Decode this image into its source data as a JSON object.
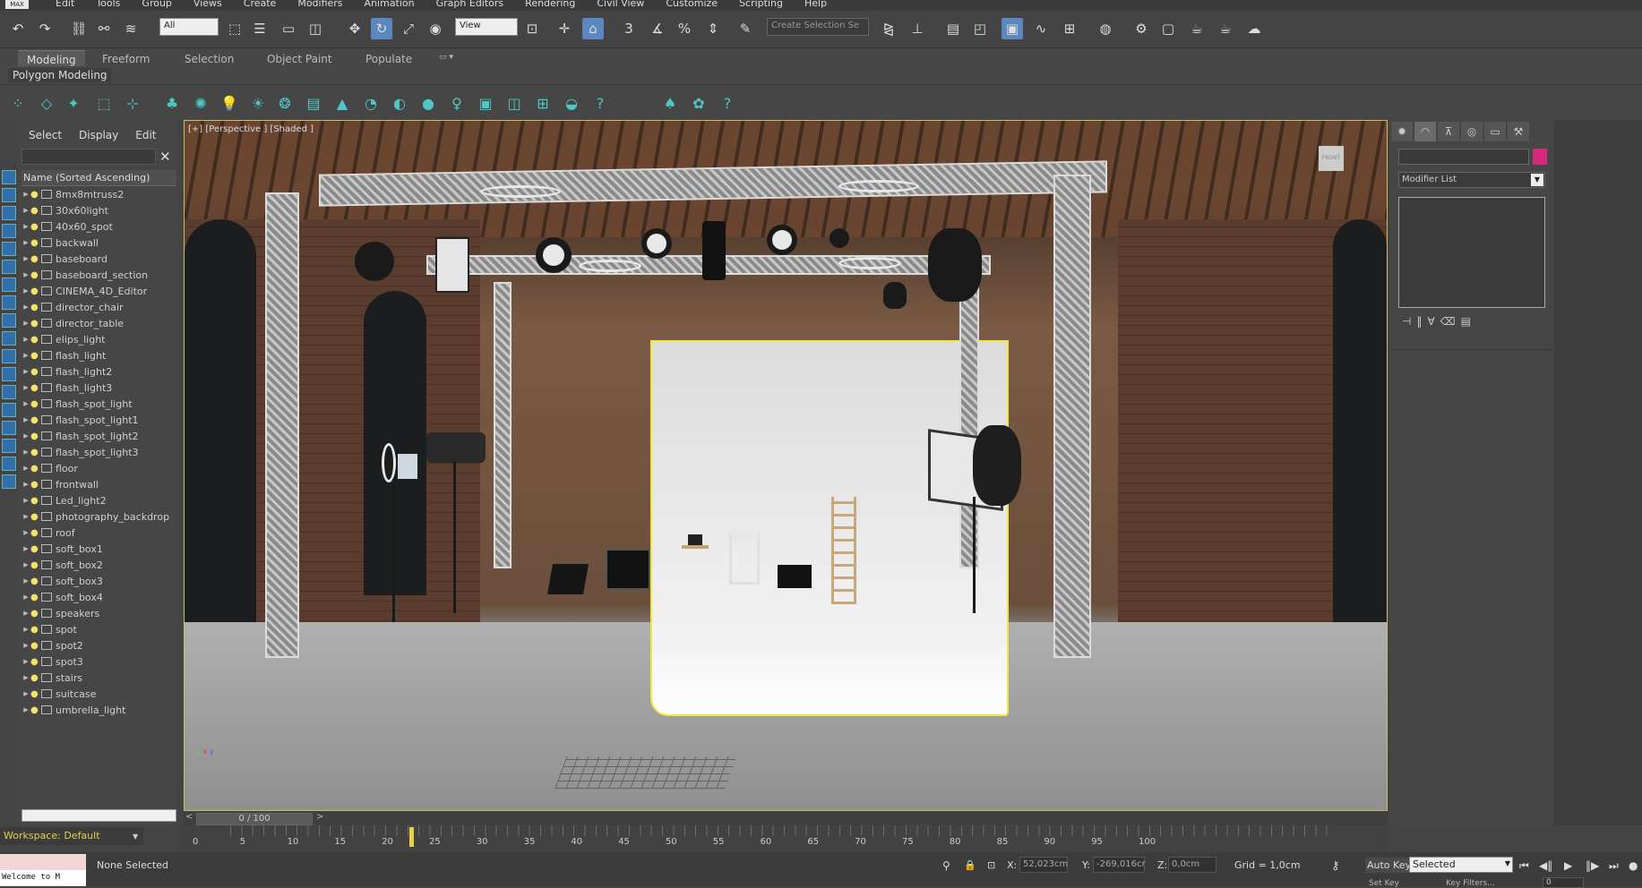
{
  "menubar": {
    "logo": "MAX",
    "items": [
      "Edit",
      "Tools",
      "Group",
      "Views",
      "Create",
      "Modifiers",
      "Animation",
      "Graph Editors",
      "Rendering",
      "Civil View",
      "Customize",
      "Scripting",
      "Help"
    ]
  },
  "main_toolbar": {
    "selection_filter": "All",
    "reference_coord": "View",
    "named_selection_placeholder": "Create Selection Se",
    "snap_labels": [
      "3",
      "%"
    ]
  },
  "ribbon": {
    "tabs": [
      "Modeling",
      "Freeform",
      "Selection",
      "Object Paint",
      "Populate"
    ],
    "active_tab": "Modeling",
    "panel_label": "Polygon Modeling"
  },
  "scene_explorer": {
    "tabs": [
      "Select",
      "Display",
      "Edit"
    ],
    "column_header": "Name (Sorted Ascending)",
    "objects": [
      {
        "name": "8mx8mtruss2",
        "light": true
      },
      {
        "name": "30x60light",
        "light": true
      },
      {
        "name": "40x60_spot",
        "light": true
      },
      {
        "name": "backwall",
        "light": true
      },
      {
        "name": "baseboard",
        "light": true
      },
      {
        "name": "baseboard_section",
        "light": true
      },
      {
        "name": "CINEMA_4D_Editor",
        "light": true
      },
      {
        "name": "director_chair",
        "light": true
      },
      {
        "name": "director_table",
        "light": true
      },
      {
        "name": "elips_light",
        "light": true
      },
      {
        "name": "flash_light",
        "light": true
      },
      {
        "name": "flash_light2",
        "light": true
      },
      {
        "name": "flash_light3",
        "light": true
      },
      {
        "name": "flash_spot_light",
        "light": true
      },
      {
        "name": "flash_spot_light1",
        "light": true
      },
      {
        "name": "flash_spot_light2",
        "light": true
      },
      {
        "name": "flash_spot_light3",
        "light": true
      },
      {
        "name": "floor",
        "light": true
      },
      {
        "name": "frontwall",
        "light": true
      },
      {
        "name": "Led_light2",
        "light": true
      },
      {
        "name": "photography_backdrop",
        "light": true
      },
      {
        "name": "roof",
        "light": true
      },
      {
        "name": "soft_box1",
        "light": true
      },
      {
        "name": "soft_box2",
        "light": true
      },
      {
        "name": "soft_box3",
        "light": true
      },
      {
        "name": "soft_box4",
        "light": true
      },
      {
        "name": "speakers",
        "light": true
      },
      {
        "name": "spot",
        "light": true
      },
      {
        "name": "spot2",
        "light": true
      },
      {
        "name": "spot3",
        "light": true
      },
      {
        "name": "stairs",
        "light": true
      },
      {
        "name": "suitcase",
        "light": true
      },
      {
        "name": "umbrella_light",
        "light": true
      }
    ]
  },
  "viewport": {
    "label": "[+] [Perspective ] [Shaded ]",
    "navcube_label": "FRONT"
  },
  "command_panel": {
    "modifier_list": "Modifier List",
    "object_color": "#d8287c"
  },
  "timeline": {
    "slider_label": "0 / 100",
    "ticks": [
      "0",
      "5",
      "10",
      "15",
      "20",
      "25",
      "30",
      "35",
      "40",
      "45",
      "50",
      "55",
      "60",
      "65",
      "70",
      "75",
      "80",
      "85",
      "90",
      "95",
      "100"
    ],
    "current_frame": 0
  },
  "workspace": "Workspace: Default",
  "status": {
    "listener": "Welcome to M",
    "selection": "None Selected",
    "x_label": "X:",
    "x_value": "52,023cm",
    "y_label": "Y:",
    "y_value": "-269,016cr",
    "z_label": "Z:",
    "z_value": "0,0cm",
    "grid": "Grid = 1,0cm",
    "auto_key": "Auto Key",
    "key_mode": "Selected",
    "set_key": "Set Key",
    "key_filters": "Key Filters...",
    "frame": "0"
  },
  "colors": {
    "accent_active": "#5a87bd",
    "selection_highlight": "#f0e83a",
    "teal_icons": "#4fc7c7",
    "frame_cursor": "#e4d24c"
  }
}
